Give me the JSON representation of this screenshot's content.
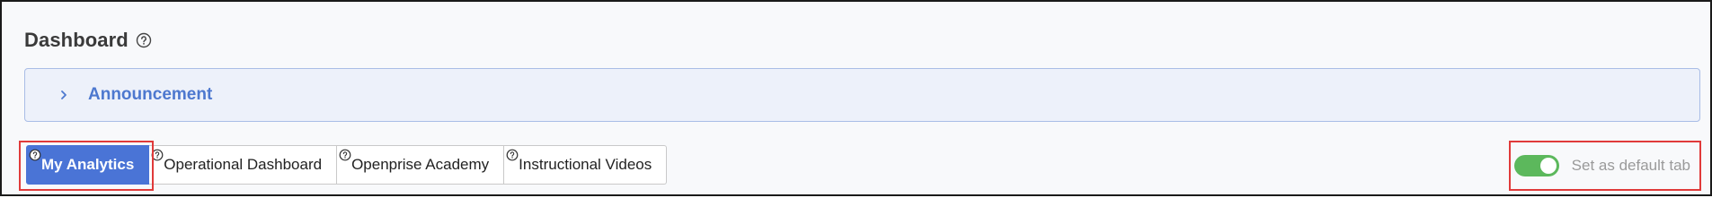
{
  "header": {
    "title": "Dashboard",
    "help_icon": "question-circle-icon"
  },
  "announcement": {
    "label": "Announcement",
    "icon": "chevron-right-icon"
  },
  "tabs": [
    {
      "label": "My Analytics",
      "active": true
    },
    {
      "label": "Operational Dashboard",
      "active": false
    },
    {
      "label": "Openprise Academy",
      "active": false
    },
    {
      "label": "Instructional Videos",
      "active": false
    }
  ],
  "default_tab_toggle": {
    "label": "Set as default tab",
    "on": true
  },
  "colors": {
    "accent": "#4a74d6",
    "announcement_text": "#4d78cf",
    "toggle_on": "#5cb85c",
    "highlight": "#e03a3a"
  }
}
